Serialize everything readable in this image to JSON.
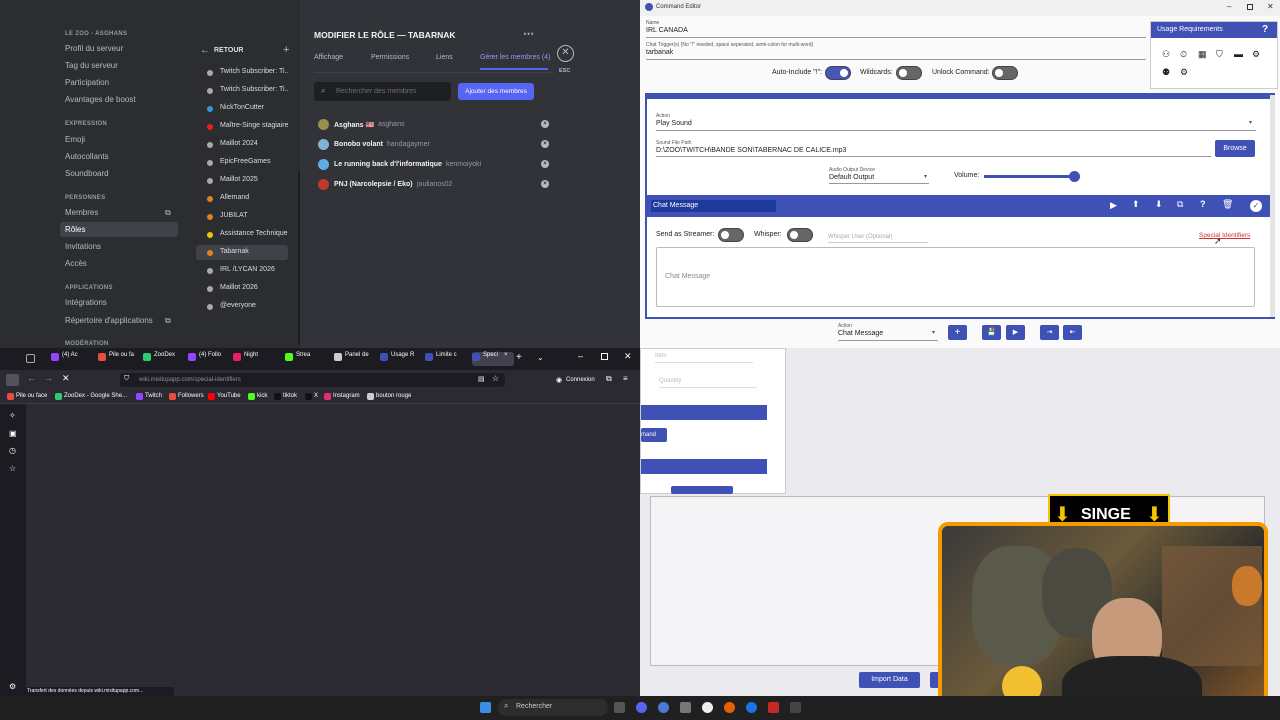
{
  "discord": {
    "server_name": "LE ZOO - ASGHANS",
    "menu": [
      {
        "type": "item",
        "label": "Profil du serveur"
      },
      {
        "type": "item",
        "label": "Tag du serveur"
      },
      {
        "type": "item",
        "label": "Participation"
      },
      {
        "type": "item",
        "label": "Avantages de boost"
      },
      {
        "type": "section",
        "label": "EXPRESSION"
      },
      {
        "type": "item",
        "label": "Emoji"
      },
      {
        "type": "item",
        "label": "Autocollants"
      },
      {
        "type": "item",
        "label": "Soundboard"
      },
      {
        "type": "section",
        "label": "PERSONNES"
      },
      {
        "type": "item",
        "label": "Membres"
      },
      {
        "type": "item",
        "label": "Rôles",
        "selected": true
      },
      {
        "type": "item",
        "label": "Invitations"
      },
      {
        "type": "item",
        "label": "Accès"
      },
      {
        "type": "section",
        "label": "APPLICATIONS"
      },
      {
        "type": "item",
        "label": "Intégrations"
      },
      {
        "type": "item",
        "label": "Répertoire d'applications"
      },
      {
        "type": "section",
        "label": "MODÉRATION"
      }
    ],
    "back_label": "RETOUR",
    "add_symbol": "+",
    "roles": [
      {
        "name": "Twitch Subscriber: Ti...",
        "color": "#aaaaaa"
      },
      {
        "name": "Twitch Subscriber: Ti...",
        "color": "#aaaaaa"
      },
      {
        "name": "NickTonCutter",
        "color": "#3498db"
      },
      {
        "name": "Maître-Singe stagiaire",
        "color": "#e91e1e"
      },
      {
        "name": "Maillot 2024",
        "color": "#aaaaaa"
      },
      {
        "name": "EpicFreeGames",
        "color": "#aaaaaa"
      },
      {
        "name": "Maillot 2025",
        "color": "#aaaaaa"
      },
      {
        "name": "Allemand",
        "color": "#e67e22"
      },
      {
        "name": "JUBILAT",
        "color": "#e67e22"
      },
      {
        "name": "Assistance Technique",
        "color": "#f1c40f"
      },
      {
        "name": "Tabarnak",
        "color": "#e67e22",
        "selected": true
      },
      {
        "name": "IRL /LYCAN 2026",
        "color": "#aaaaaa"
      },
      {
        "name": "Maillot 2026",
        "color": "#aaaaaa"
      },
      {
        "name": "@everyone",
        "color": "#aaaaaa"
      }
    ],
    "title": "MODIFIER LE RÔLE — TABARNAK",
    "tabs": [
      "Affichage",
      "Permissions",
      "Liens",
      "Gérer les membres (4)"
    ],
    "active_tab": 3,
    "esc_label": "ESC",
    "search_placeholder": "Rechercher des membres",
    "add_members_label": "Ajouter des membres",
    "members": [
      {
        "name": "Asghans 🇺🇸",
        "user": "asghans",
        "color": "#9b8f4a"
      },
      {
        "name": "Bonobo volant",
        "user": "handagaymer",
        "color": "#7fb3d5"
      },
      {
        "name": "Le running back d'l'informatique",
        "user": "kenmoiyoki",
        "color": "#5dade2"
      },
      {
        "name": "PNJ (Narcolepsie / Eko)",
        "user": "joulianos02",
        "color": "#c0392b"
      }
    ]
  },
  "browser": {
    "tabs": [
      {
        "label": "(4) Ac",
        "color": "#9146ff"
      },
      {
        "label": "Pile ou fa",
        "color": "#e74c3c"
      },
      {
        "label": "ZooDex",
        "color": "#2ecc71"
      },
      {
        "label": "(4) Follo",
        "color": "#9146ff"
      },
      {
        "label": "Night",
        "color": "#e91e63"
      },
      {
        "label": "Strea",
        "color": "#53fc18"
      },
      {
        "label": "Panel de",
        "color": "#cccccc"
      },
      {
        "label": "Usage R",
        "color": "#3f51b5"
      },
      {
        "label": "Limite c",
        "color": "#3f51b5"
      },
      {
        "label": "Speci",
        "color": "#3f51b5",
        "active": true
      }
    ],
    "url": "wiki.mixitupapp.com/special-identifiers",
    "signin_label": "Connexion",
    "bookmarks": [
      {
        "label": "Pile ou face",
        "color": "#e74c3c"
      },
      {
        "label": "ZooDex - Google She...",
        "color": "#2ecc71"
      },
      {
        "label": "Twitch",
        "color": "#9146ff"
      },
      {
        "label": "Followers",
        "color": "#e74c3c"
      },
      {
        "label": "YouTube",
        "color": "#ff0000"
      },
      {
        "label": "kick",
        "color": "#53fc18"
      },
      {
        "label": "tiktok",
        "color": "#111111"
      },
      {
        "label": "X",
        "color": "#111111"
      },
      {
        "label": "Instagram",
        "color": "#e1306c"
      },
      {
        "label": "bouton rouge",
        "color": "#cccccc"
      }
    ],
    "status": "Transfert des données depuis wiki.mixitupapp.com..."
  },
  "cmd": {
    "window_title": "Command Editor",
    "name_label": "Name",
    "name_value": "IRL CANADA",
    "trigger_label": "Chat Trigger(s) (No \"!\" needed, space seperated, semi-colon for multi-word)",
    "trigger_value": "tarbanak",
    "auto_include_label": "Auto-Include \"!\":",
    "wildcards_label": "Wildcards:",
    "unlock_label": "Unlock Command:",
    "usage_label": "Usage Requirements",
    "help_symbol": "?",
    "action_label": "Action",
    "action_value": "Play Sound",
    "sound_path_label": "Sound File Path",
    "sound_path_value": "D:\\ZOO\\TWITCH\\BANDE SON\\TABERNAC DE CALICE.mp3",
    "browse_label": "Browse",
    "audio_device_label": "Audio Output Device",
    "audio_device_value": "Default Output",
    "volume_label": "Volume:",
    "volume_level": 0.95,
    "chat_header": "Chat Message",
    "send_streamer_label": "Send as Streamer:",
    "whisper_label": "Whisper:",
    "whisper_user_placeholder": "Whisper User (Optional)",
    "special_identifiers_label": "Special Identifiers",
    "chat_message_placeholder": "Chat Message",
    "bottom_action_label": "Action",
    "bottom_action_value": "Chat Message",
    "add_symbol": "+"
  },
  "back": {
    "item_placeholder": "Item",
    "quantity_placeholder": "Quantity",
    "command_btn": "mand",
    "import_label": "Import Data"
  },
  "webcam": {
    "overlay_text": "SINGE"
  },
  "taskbar": {
    "search_placeholder": "Rechercher"
  }
}
